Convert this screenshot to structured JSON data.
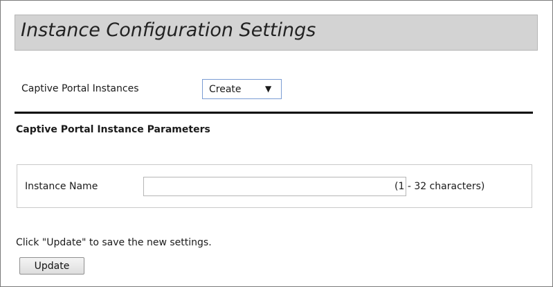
{
  "page": {
    "title": "Instance Configuration Settings"
  },
  "instances": {
    "label": "Captive Portal Instances",
    "selected": "Create",
    "caret": "▼"
  },
  "parameters": {
    "section_title": "Captive Portal Instance Parameters",
    "instance_name_label": "Instance Name",
    "instance_name_value": "",
    "instance_name_hint": "(1 - 32 characters)"
  },
  "footer": {
    "help_text": "Click \"Update\" to save the new settings.",
    "update_label": "Update"
  },
  "colors": {
    "title_bar_bg": "#d3d3d3",
    "select_border": "#7a9cd3",
    "divider": "#000000"
  }
}
